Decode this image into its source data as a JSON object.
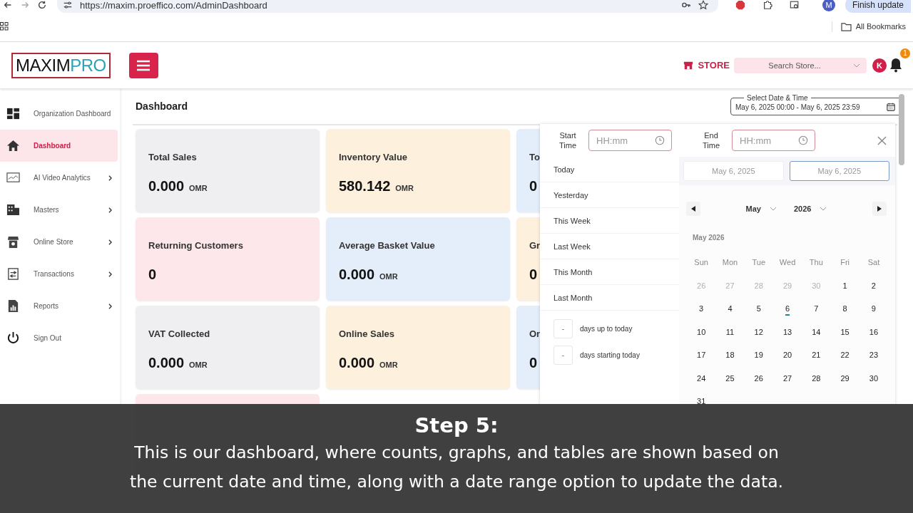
{
  "browser": {
    "url": "https://maxim.proeffico.com/AdminDashboard",
    "profile_initial": "M",
    "update_button": "Finish update",
    "bookmarks_label": "All Bookmarks"
  },
  "header": {
    "logo": {
      "part_1": "MAXIM",
      "part_2": "PRO"
    },
    "store_label": "STORE",
    "store_search": {
      "placeholder": "Search Store..."
    },
    "user_initial": "K",
    "notification_count": "1"
  },
  "sidebar": {
    "items": [
      {
        "kind": "grid",
        "label": "Organization Dashboard",
        "submenu": false,
        "selected": false
      },
      {
        "kind": "home",
        "label": "Dashboard",
        "submenu": false,
        "selected": true
      },
      {
        "kind": "monitor",
        "label": "AI Video Analytics",
        "submenu": true,
        "selected": false
      },
      {
        "kind": "building",
        "label": "Masters",
        "submenu": true,
        "selected": false
      },
      {
        "kind": "store",
        "label": "Online Store",
        "submenu": true,
        "selected": false
      },
      {
        "kind": "exchange",
        "label": "Transactions",
        "submenu": true,
        "selected": false
      },
      {
        "kind": "report",
        "label": "Reports",
        "submenu": true,
        "selected": false
      },
      {
        "kind": "power",
        "label": "Sign Out",
        "submenu": false,
        "selected": false
      }
    ]
  },
  "page_title": "Dashboard",
  "cards": [
    {
      "title": "Total Sales",
      "value": "0.000",
      "unit": "OMR",
      "color": "#efeff1"
    },
    {
      "title": "Inventory Value",
      "value": "580.142",
      "unit": "OMR",
      "color": "#fdf1de"
    },
    {
      "title": "To",
      "value": "0",
      "color": "#e4eefa"
    },
    {
      "title": "Returning Customers",
      "value": "0",
      "color": "#fde7eb"
    },
    {
      "title": "Average Basket Value",
      "value": "0.000",
      "unit": "OMR",
      "color": "#e4eefa"
    },
    {
      "title": "Gr",
      "value": "0",
      "color": "#fdf1de"
    },
    {
      "title": "VAT Collected",
      "value": "0.000",
      "unit": "OMR",
      "color": "#efeff1"
    },
    {
      "title": "Online Sales",
      "value": "0.000",
      "unit": "OMR",
      "color": "#fdf1de"
    },
    {
      "title": "Or",
      "value": "0",
      "color": "#e4eefa"
    },
    {
      "color": "#fde7eb"
    }
  ],
  "date_range": {
    "legend": "Select Date & Time",
    "value": "May 6, 2025 00:00 - May 6, 2025 23:59"
  },
  "picker": {
    "start_label": "Start Time",
    "start_time": {
      "placeholder": "HH:mm"
    },
    "end_label": "End Time",
    "end_time": {
      "placeholder": "HH:mm"
    },
    "presets": [
      "Today",
      "Yesterday",
      "This Week",
      "Last Week",
      "This Month",
      "Last Month"
    ],
    "relative": [
      {
        "value": "-",
        "label": "days up to today"
      },
      {
        "value": "-",
        "label": "days starting today"
      }
    ],
    "date_fields": [
      {
        "value": "May 6, 2025",
        "selected": false
      },
      {
        "value": "May 6, 2025",
        "selected": true
      }
    ],
    "month": "May",
    "year": "2026",
    "calendar_title": "May 2026",
    "weekdays": [
      "Sun",
      "Mon",
      "Tue",
      "Wed",
      "Thu",
      "Fri",
      "Sat"
    ],
    "weeks": [
      [
        {
          "day": "26",
          "outside": true,
          "today": false
        },
        {
          "day": "27",
          "outside": true,
          "today": false
        },
        {
          "day": "28",
          "outside": true,
          "today": false
        },
        {
          "day": "29",
          "outside": true,
          "today": false
        },
        {
          "day": "30",
          "outside": true,
          "today": false
        },
        {
          "day": "1",
          "outside": false,
          "today": false
        },
        {
          "day": "2",
          "outside": false,
          "today": false
        }
      ],
      [
        {
          "day": "3",
          "outside": false,
          "today": false
        },
        {
          "day": "4",
          "outside": false,
          "today": false
        },
        {
          "day": "5",
          "outside": false,
          "today": false
        },
        {
          "day": "6",
          "outside": false,
          "today": true
        },
        {
          "day": "7",
          "outside": false,
          "today": false
        },
        {
          "day": "8",
          "outside": false,
          "today": false
        },
        {
          "day": "9",
          "outside": false,
          "today": false
        }
      ],
      [
        {
          "day": "10",
          "outside": false,
          "today": false
        },
        {
          "day": "11",
          "outside": false,
          "today": false
        },
        {
          "day": "12",
          "outside": false,
          "today": false
        },
        {
          "day": "13",
          "outside": false,
          "today": false
        },
        {
          "day": "14",
          "outside": false,
          "today": false
        },
        {
          "day": "15",
          "outside": false,
          "today": false
        },
        {
          "day": "16",
          "outside": false,
          "today": false
        }
      ],
      [
        {
          "day": "17",
          "outside": false,
          "today": false
        },
        {
          "day": "18",
          "outside": false,
          "today": false
        },
        {
          "day": "19",
          "outside": false,
          "today": false
        },
        {
          "day": "20",
          "outside": false,
          "today": false
        },
        {
          "day": "21",
          "outside": false,
          "today": false
        },
        {
          "day": "22",
          "outside": false,
          "today": false
        },
        {
          "day": "23",
          "outside": false,
          "today": false
        }
      ],
      [
        {
          "day": "24",
          "outside": false,
          "today": false
        },
        {
          "day": "25",
          "outside": false,
          "today": false
        },
        {
          "day": "26",
          "outside": false,
          "today": false
        },
        {
          "day": "27",
          "outside": false,
          "today": false
        },
        {
          "day": "28",
          "outside": false,
          "today": false
        },
        {
          "day": "29",
          "outside": false,
          "today": false
        },
        {
          "day": "30",
          "outside": false,
          "today": false
        }
      ],
      [
        {
          "day": "31",
          "outside": false,
          "today": false
        }
      ]
    ]
  },
  "caption": {
    "title": "Step 5:",
    "lines": [
      "This is our dashboard, where counts, graphs, and tables are shown based on",
      "the current date and time, along with a date range option to update the data."
    ]
  }
}
